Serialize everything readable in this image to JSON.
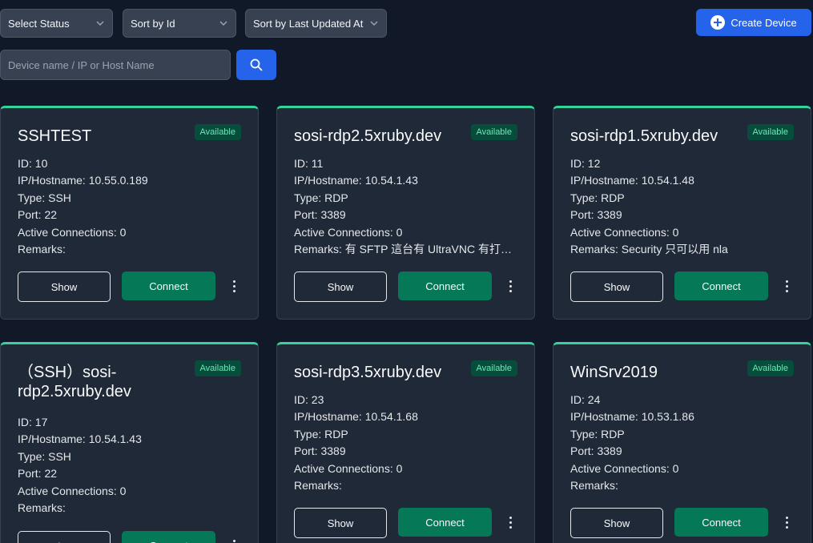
{
  "filters": {
    "status": "Select Status",
    "sort_by": "Sort by Id",
    "sort_by_updated": "Sort by Last Updated At"
  },
  "create_button": "Create Device",
  "search": {
    "placeholder": "Device name / IP or Host Name"
  },
  "cards": [
    {
      "title": "SSHTEST",
      "badge": "Available",
      "id": "ID: 10",
      "ip": "IP/Hostname: 10.55.0.189",
      "type": "Type: SSH",
      "port": "Port: 22",
      "connections": "Active Connections: 0",
      "remarks": "Remarks:",
      "show": "Show",
      "connect": "Connect"
    },
    {
      "title": "sosi-rdp2.5xruby.dev",
      "badge": "Available",
      "id": "ID: 11",
      "ip": "IP/Hostname: 10.54.1.43",
      "type": "Type: RDP",
      "port": "Port: 3389",
      "connections": "Active Connections: 0",
      "remarks": "Remarks: 有 SFTP 這台有 UltraVNC 有打…",
      "show": "Show",
      "connect": "Connect"
    },
    {
      "title": "sosi-rdp1.5xruby.dev",
      "badge": "Available",
      "id": "ID: 12",
      "ip": "IP/Hostname: 10.54.1.48",
      "type": "Type: RDP",
      "port": "Port: 3389",
      "connections": "Active Connections: 0",
      "remarks": "Remarks: Security 只可以用 nla",
      "show": "Show",
      "connect": "Connect"
    },
    {
      "title": "（SSH）sosi-rdp2.5xruby.dev",
      "badge": "Available",
      "id": "ID: 17",
      "ip": "IP/Hostname: 10.54.1.43",
      "type": "Type: SSH",
      "port": "Port: 22",
      "connections": "Active Connections: 0",
      "remarks": "Remarks:",
      "show": "Show",
      "connect": "Connect"
    },
    {
      "title": "sosi-rdp3.5xruby.dev",
      "badge": "Available",
      "id": "ID: 23",
      "ip": "IP/Hostname: 10.54.1.68",
      "type": "Type: RDP",
      "port": "Port: 3389",
      "connections": "Active Connections: 0",
      "remarks": "Remarks:",
      "show": "Show",
      "connect": "Connect"
    },
    {
      "title": "WinSrv2019",
      "badge": "Available",
      "id": "ID: 24",
      "ip": "IP/Hostname: 10.53.1.86",
      "type": "Type: RDP",
      "port": "Port: 3389",
      "connections": "Active Connections: 0",
      "remarks": "Remarks:",
      "show": "Show",
      "connect": "Connect"
    }
  ],
  "colors": {
    "background": "#111827",
    "card": "#1f2937",
    "accent": "#2563eb",
    "connect": "#047857",
    "available": "#34d399"
  }
}
